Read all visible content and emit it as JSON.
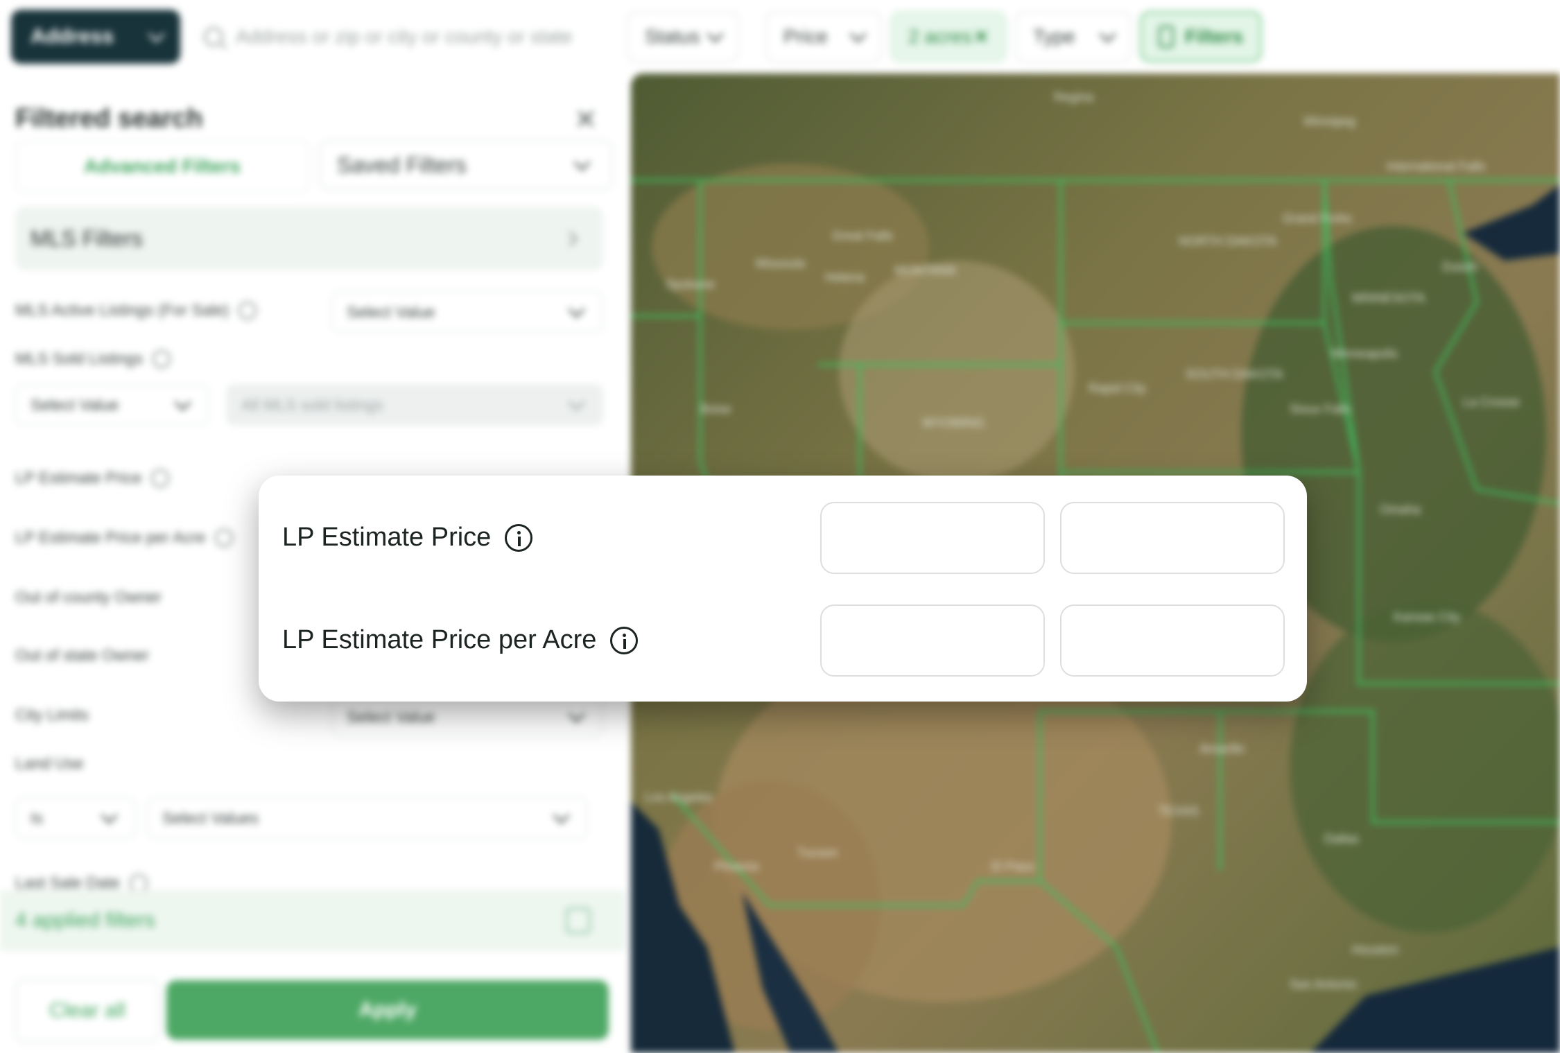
{
  "topbar": {
    "address_button": "Address",
    "search_placeholder": "Address or zip or city or county or state",
    "pills": {
      "status": "Status",
      "price": "Price",
      "acres": "2 acres",
      "type": "Type",
      "filters": "Filters"
    }
  },
  "panel": {
    "title": "Filtered search",
    "tabs": {
      "advanced": "Advanced Filters",
      "saved": "Saved Filters"
    },
    "mls_section": "MLS Filters",
    "rows": {
      "mls_active": "MLS Active Listings (For Sale)",
      "mls_sold": "MLS Sold Listings",
      "lp_price": "LP Estimate Price",
      "lp_price_acre": "LP Estimate Price per Acre",
      "out_county": "Out of county Owner",
      "out_state": "Out of state Owner",
      "city_limits": "City Limits",
      "land_use": "Land Use",
      "last_sale": "Last Sale Date"
    },
    "selects": {
      "select_value": "Select Value",
      "all_mls_sold": "All MLS sold listings",
      "is": "Is",
      "select_values": "Select Values"
    },
    "applied": "4 applied filters",
    "clear_all": "Clear all",
    "apply": "Apply"
  },
  "map": {
    "labels": [
      "Regina",
      "Winnipeg",
      "International Falls",
      "Grand Forks",
      "NORTH DAKOTA",
      "Duluth",
      "Missoula",
      "Helena",
      "Great Falls",
      "MONTANA",
      "Spokane",
      "MINNESOTA",
      "Minneapolis",
      "Boise",
      "SOUTH DAKOTA",
      "Rapid City",
      "Sioux Falls",
      "La Crosse",
      "WYOMING",
      "Omaha",
      "Kansas City",
      "Los Angeles",
      "Phoenix",
      "Tucson",
      "El Paso",
      "Dallas",
      "San Antonio",
      "Houston",
      "Amarillo",
      "TEXAS"
    ]
  },
  "callout": {
    "row1": "LP Estimate Price",
    "row2": "LP Estimate Price per Acre"
  }
}
